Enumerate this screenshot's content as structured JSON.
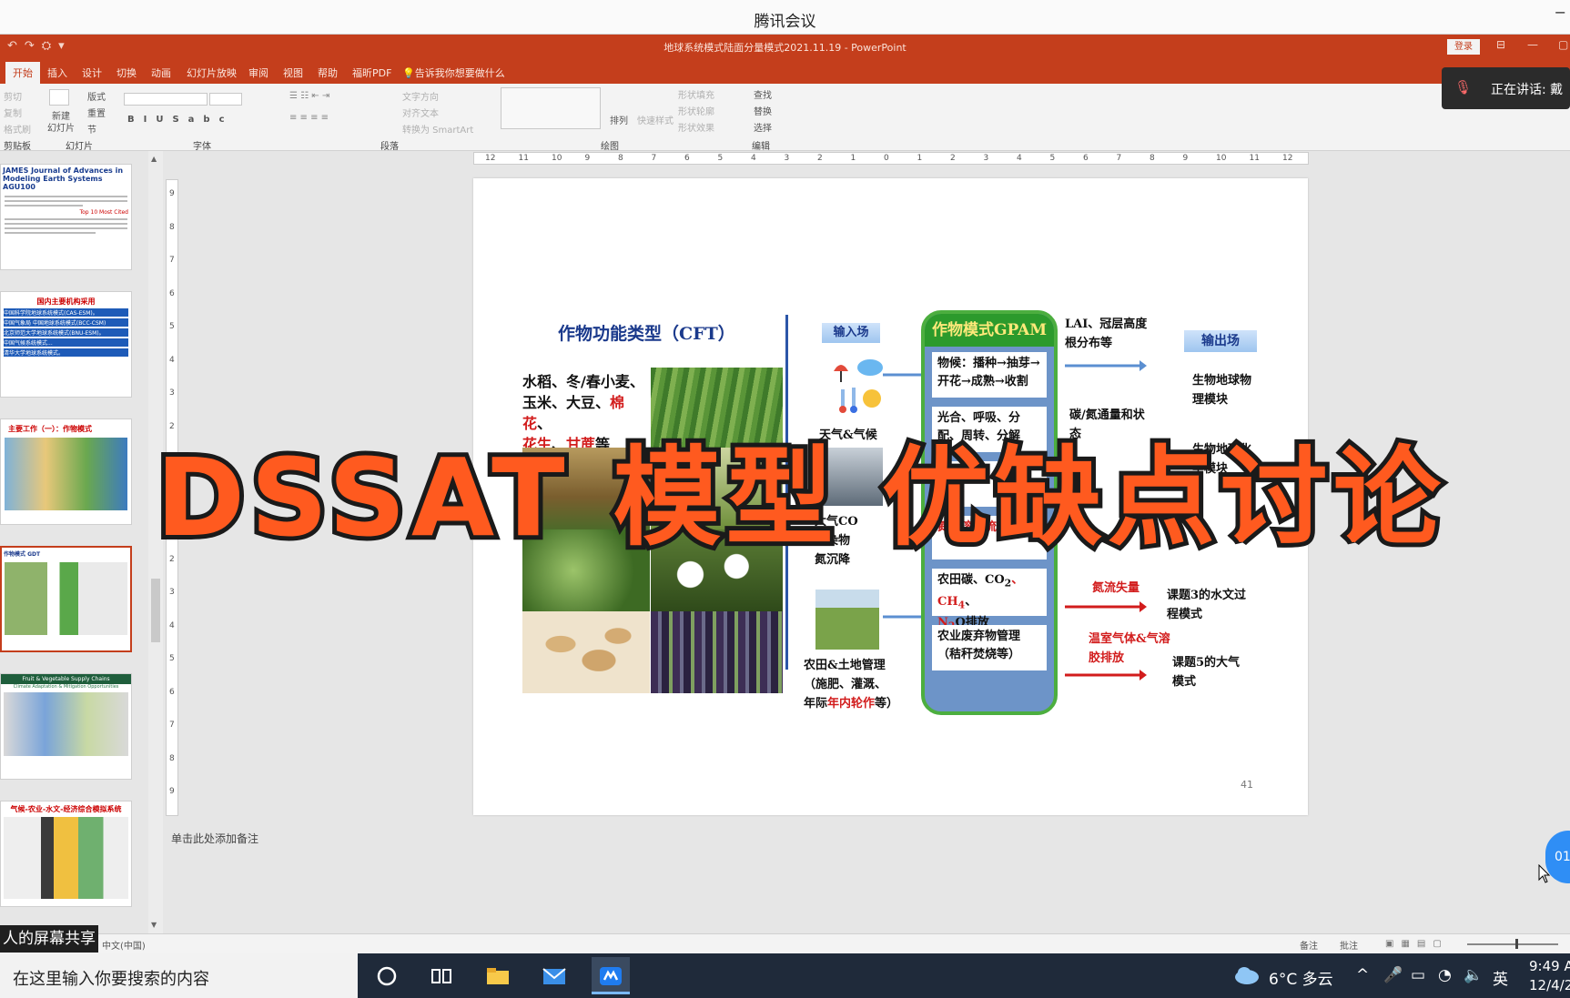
{
  "meeting": {
    "title": "腾讯会议",
    "minimize": "−"
  },
  "ppt": {
    "doc_title": "地球系统模式陆面分量模式2021.11.19 - PowerPoint",
    "login": "登录",
    "tabs": [
      "开始",
      "插入",
      "设计",
      "切换",
      "动画",
      "幻灯片放映",
      "审阅",
      "视图",
      "帮助",
      "福昕PDF"
    ],
    "tell_me": "告诉我你想要做什么",
    "ribbon": {
      "clipboard_items": [
        "剪切",
        "复制",
        "格式刷"
      ],
      "clipboard_label": "剪贴板",
      "new_slide": "新建\n幻灯片",
      "layout": "版式",
      "reset": "重置",
      "section": "节",
      "slides_label": "幻灯片",
      "font_label": "字体",
      "para_items": [
        "文字方向",
        "对齐文本",
        "转换为 SmartArt"
      ],
      "para_label": "段落",
      "arrange": "排列",
      "quick_styles": "快速样式",
      "shape_items": [
        "形状填充",
        "形状轮廓",
        "形状效果"
      ],
      "drawing_label": "绘图",
      "edit_items": [
        "查找",
        "替换",
        "选择"
      ],
      "edit_label": "编辑"
    },
    "speaking": "正在讲话: 戴",
    "ruler_h": [
      "12",
      "11",
      "10",
      "9",
      "8",
      "7",
      "6",
      "5",
      "4",
      "3",
      "2",
      "1",
      "0",
      "1",
      "2",
      "3",
      "4",
      "5",
      "6",
      "7",
      "8",
      "9",
      "10",
      "11",
      "12"
    ],
    "ruler_v": [
      "9",
      "8",
      "7",
      "6",
      "5",
      "4",
      "3",
      "2",
      "1",
      "0",
      "1",
      "2",
      "3",
      "4",
      "5",
      "6",
      "7",
      "8",
      "9"
    ],
    "thumbnails": [
      {
        "head": "JAMES  Journal of Advances in Modeling Earth Systems   AGU100",
        "note": "Top 10 Most Cited"
      },
      {
        "head": "国内主要机构采用",
        "rows": [
          "中国科学院地球系统模式(CAS-ESM)。",
          "中国气象局 中国地球系统模式(BCC-CSM)",
          "北京师范大学地球系统模式(BNU-ESM)。",
          "中国气候系统模式...",
          "清华大学地球系统模式。"
        ]
      },
      {
        "head": "主要工作（一）：作物模式"
      },
      {
        "head": "作物模式 GDT"
      },
      {
        "head": "Fruit & Vegetable Supply Chains",
        "sub": "Climate Adaptation & Mitigation Opportunities"
      },
      {
        "head": "气候-农业-水文-经济综合模拟系统"
      }
    ],
    "notes_placeholder": "单击此处添加备注",
    "status_lang": "中文(中国)",
    "status_notes": "备注",
    "status_comments": "批注"
  },
  "slide": {
    "cft_title": "作物功能类型（CFT）",
    "crops_line1": "水稻、冬/春小麦、",
    "crops_line2a": "玉米、大豆、",
    "crops_line2b": "棉花",
    "crops_line2c": "、",
    "crops_line3a": "花生",
    "crops_line3b": "、",
    "crops_line3c": "甘蔗",
    "crops_line3d": "等",
    "input_field": "输入场",
    "weather_label": "天气&气候",
    "pollution_label1": "大气CO",
    "pollution_label2": "污染物",
    "pollution_label3": "氮沉降",
    "mgmt_line1": "农田&土地管理",
    "mgmt_line2": "（施肥、灌溉、",
    "mgmt_line3a": "年际",
    "mgmt_line3b": "年内轮作",
    "mgmt_line3c": "等）",
    "gpam_title": "作物模式GPAM",
    "gpam_cell1": "物候：播种→抽芽→开花→成熟→收割",
    "gpam_cell2": "光合、呼吸、分配、周转、分解",
    "gpam_cell3": "氮淋溶径流等）",
    "gpam_cell4a": "农田碳、CO",
    "gpam_cell4b": "、CH",
    "gpam_cell4c": "、",
    "gpam_cell4d": "N",
    "gpam_cell4e": "O排放",
    "gpam_cell5": "农业废弃物管理（秸秆焚烧等）",
    "out1": "LAI、冠层高度根分布等",
    "out2": "碳/氮通量和状态",
    "out3": "氮流失量",
    "out4": "温室气体&气溶胶排放",
    "output_field": "输出场",
    "dest1": "生物地球物理模块",
    "dest2": "生物地球化学模块",
    "dest3": "课题3的水文过程模式",
    "dest4": "课题5的大气模式",
    "slide_number": "41"
  },
  "overlay_title": "DSSAT 模型 优缺点讨论",
  "share_banner": "人的屏幕共享",
  "badge": "01",
  "taskbar": {
    "search_placeholder": "在这里输入你要搜索的内容",
    "weather": "6°C 多云",
    "ime": "英",
    "time": "9:49 A",
    "date": "12/4/20"
  },
  "colors": {
    "accent": "#c43e1c",
    "title_fill": "#ff5a1f",
    "title_stroke": "#1a1a1a",
    "gpam_green": "#2c9a2c"
  }
}
